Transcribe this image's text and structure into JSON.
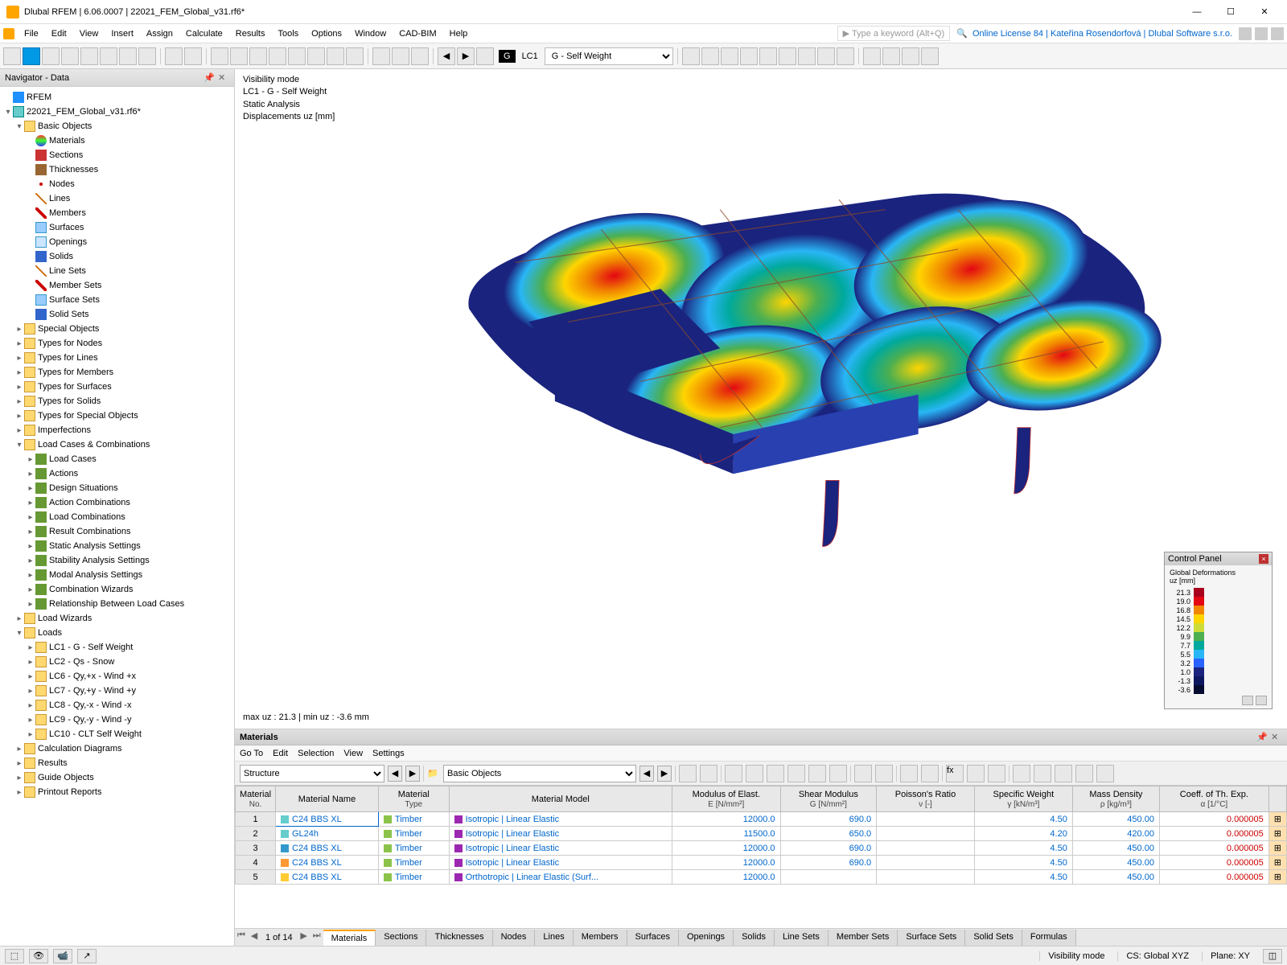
{
  "titlebar": {
    "title": "Dlubal RFEM | 6.06.0007 | 22021_FEM_Global_v31.rf6*"
  },
  "menu": {
    "items": [
      "File",
      "Edit",
      "View",
      "Insert",
      "Assign",
      "Calculate",
      "Results",
      "Tools",
      "Options",
      "Window",
      "CAD-BIM",
      "Help"
    ],
    "keyword_placeholder": "Type a keyword (Alt+Q)",
    "license": "Online License 84 | Kateřina Rosendorfová | Dlubal Software s.r.o."
  },
  "toolbar": {
    "lc_code": "LC1",
    "lc_name": "G - Self Weight"
  },
  "navigator": {
    "title": "Navigator - Data",
    "root": "RFEM",
    "file": "22021_FEM_Global_v31.rf6*",
    "basic": {
      "label": "Basic Objects",
      "items": [
        "Materials",
        "Sections",
        "Thicknesses",
        "Nodes",
        "Lines",
        "Members",
        "Surfaces",
        "Openings",
        "Solids",
        "Line Sets",
        "Member Sets",
        "Surface Sets",
        "Solid Sets"
      ]
    },
    "groups1": [
      "Special Objects",
      "Types for Nodes",
      "Types for Lines",
      "Types for Members",
      "Types for Surfaces",
      "Types for Solids",
      "Types for Special Objects",
      "Imperfections"
    ],
    "lcac": {
      "label": "Load Cases & Combinations",
      "items": [
        "Load Cases",
        "Actions",
        "Design Situations",
        "Action Combinations",
        "Load Combinations",
        "Result Combinations",
        "Static Analysis Settings",
        "Stability Analysis Settings",
        "Modal Analysis Settings",
        "Combination Wizards",
        "Relationship Between Load Cases"
      ]
    },
    "loadwiz": "Load Wizards",
    "loads": {
      "label": "Loads",
      "items": [
        "LC1 - G - Self Weight",
        "LC2 - Qs - Snow",
        "LC6 - Qy,+x - Wind +x",
        "LC7 - Qy,+y - Wind +y",
        "LC8 - Qy,-x - Wind -x",
        "LC9 - Qy,-y - Wind -y",
        "LC10 - CLT Self Weight"
      ]
    },
    "tail": [
      "Calculation Diagrams",
      "Results",
      "Guide Objects",
      "Printout Reports"
    ]
  },
  "viewport": {
    "lines": [
      "Visibility mode",
      "LC1 - G - Self Weight",
      "Static Analysis",
      "Displacements uᴢ [mm]"
    ],
    "footer": "max uᴢ : 21.3  |  min uᴢ : -3.6 mm"
  },
  "ctrl": {
    "title": "Control Panel",
    "subtitle": "Global Deformations\nuᴢ [mm]",
    "legend": [
      {
        "v": "21.3",
        "c": "#a8001c"
      },
      {
        "v": "19.0",
        "c": "#e30613"
      },
      {
        "v": "16.8",
        "c": "#f18700"
      },
      {
        "v": "14.5",
        "c": "#ffd500"
      },
      {
        "v": "12.2",
        "c": "#cddc39"
      },
      {
        "v": "9.9",
        "c": "#4caf50"
      },
      {
        "v": "7.7",
        "c": "#00a99d"
      },
      {
        "v": "5.5",
        "c": "#29b6f6"
      },
      {
        "v": "3.2",
        "c": "#2962ff"
      },
      {
        "v": "1.0",
        "c": "#1a237e"
      },
      {
        "v": "-1.3",
        "c": "#0d1760"
      },
      {
        "v": "-3.6",
        "c": "#050a30"
      }
    ]
  },
  "panel": {
    "title": "Materials",
    "menu": [
      "Go To",
      "Edit",
      "Selection",
      "View",
      "Settings"
    ],
    "dropdown1": "Structure",
    "dropdown2": "Basic Objects",
    "headers": [
      {
        "l1": "Material",
        "l2": "No."
      },
      {
        "l1": "Material Name",
        "l2": ""
      },
      {
        "l1": "Material",
        "l2": "Type"
      },
      {
        "l1": "Material Model",
        "l2": ""
      },
      {
        "l1": "Modulus of Elast.",
        "l2": "E [N/mm²]"
      },
      {
        "l1": "Shear Modulus",
        "l2": "G [N/mm²]"
      },
      {
        "l1": "Poisson's Ratio",
        "l2": "ν [-]"
      },
      {
        "l1": "Specific Weight",
        "l2": "γ [kN/m³]"
      },
      {
        "l1": "Mass Density",
        "l2": "ρ [kg/m³]"
      },
      {
        "l1": "Coeff. of Th. Exp.",
        "l2": "α [1/°C]"
      },
      {
        "l1": "",
        "l2": ""
      }
    ],
    "rows": [
      {
        "no": "1",
        "c": "#66cccc",
        "name": "C24 BBS XL",
        "type": "Timber",
        "model": "Isotropic | Linear Elastic",
        "E": "12000.0",
        "G": "690.0",
        "nu": "",
        "sw": "4.50",
        "md": "450.00",
        "alpha": "0.000005",
        "sel": true
      },
      {
        "no": "2",
        "c": "#66cccc",
        "name": "GL24h",
        "type": "Timber",
        "model": "Isotropic | Linear Elastic",
        "E": "11500.0",
        "G": "650.0",
        "nu": "",
        "sw": "4.20",
        "md": "420.00",
        "alpha": "0.000005"
      },
      {
        "no": "3",
        "c": "#3399cc",
        "name": "C24 BBS XL",
        "type": "Timber",
        "model": "Isotropic | Linear Elastic",
        "E": "12000.0",
        "G": "690.0",
        "nu": "",
        "sw": "4.50",
        "md": "450.00",
        "alpha": "0.000005"
      },
      {
        "no": "4",
        "c": "#ff9933",
        "name": "C24 BBS XL",
        "type": "Timber",
        "model": "Isotropic | Linear Elastic",
        "E": "12000.0",
        "G": "690.0",
        "nu": "",
        "sw": "4.50",
        "md": "450.00",
        "alpha": "0.000005"
      },
      {
        "no": "5",
        "c": "#ffcc33",
        "name": "C24 BBS XL",
        "type": "Timber",
        "model": "Orthotropic | Linear Elastic (Surf...",
        "E": "12000.0",
        "G": "",
        "nu": "",
        "sw": "4.50",
        "md": "450.00",
        "alpha": "0.000005"
      }
    ],
    "page": "1 of 14",
    "tabs": [
      "Materials",
      "Sections",
      "Thicknesses",
      "Nodes",
      "Lines",
      "Members",
      "Surfaces",
      "Openings",
      "Solids",
      "Line Sets",
      "Member Sets",
      "Surface Sets",
      "Solid Sets",
      "Formulas"
    ]
  },
  "status": {
    "vis": "Visibility mode",
    "cs": "CS: Global XYZ",
    "plane": "Plane: XY"
  }
}
